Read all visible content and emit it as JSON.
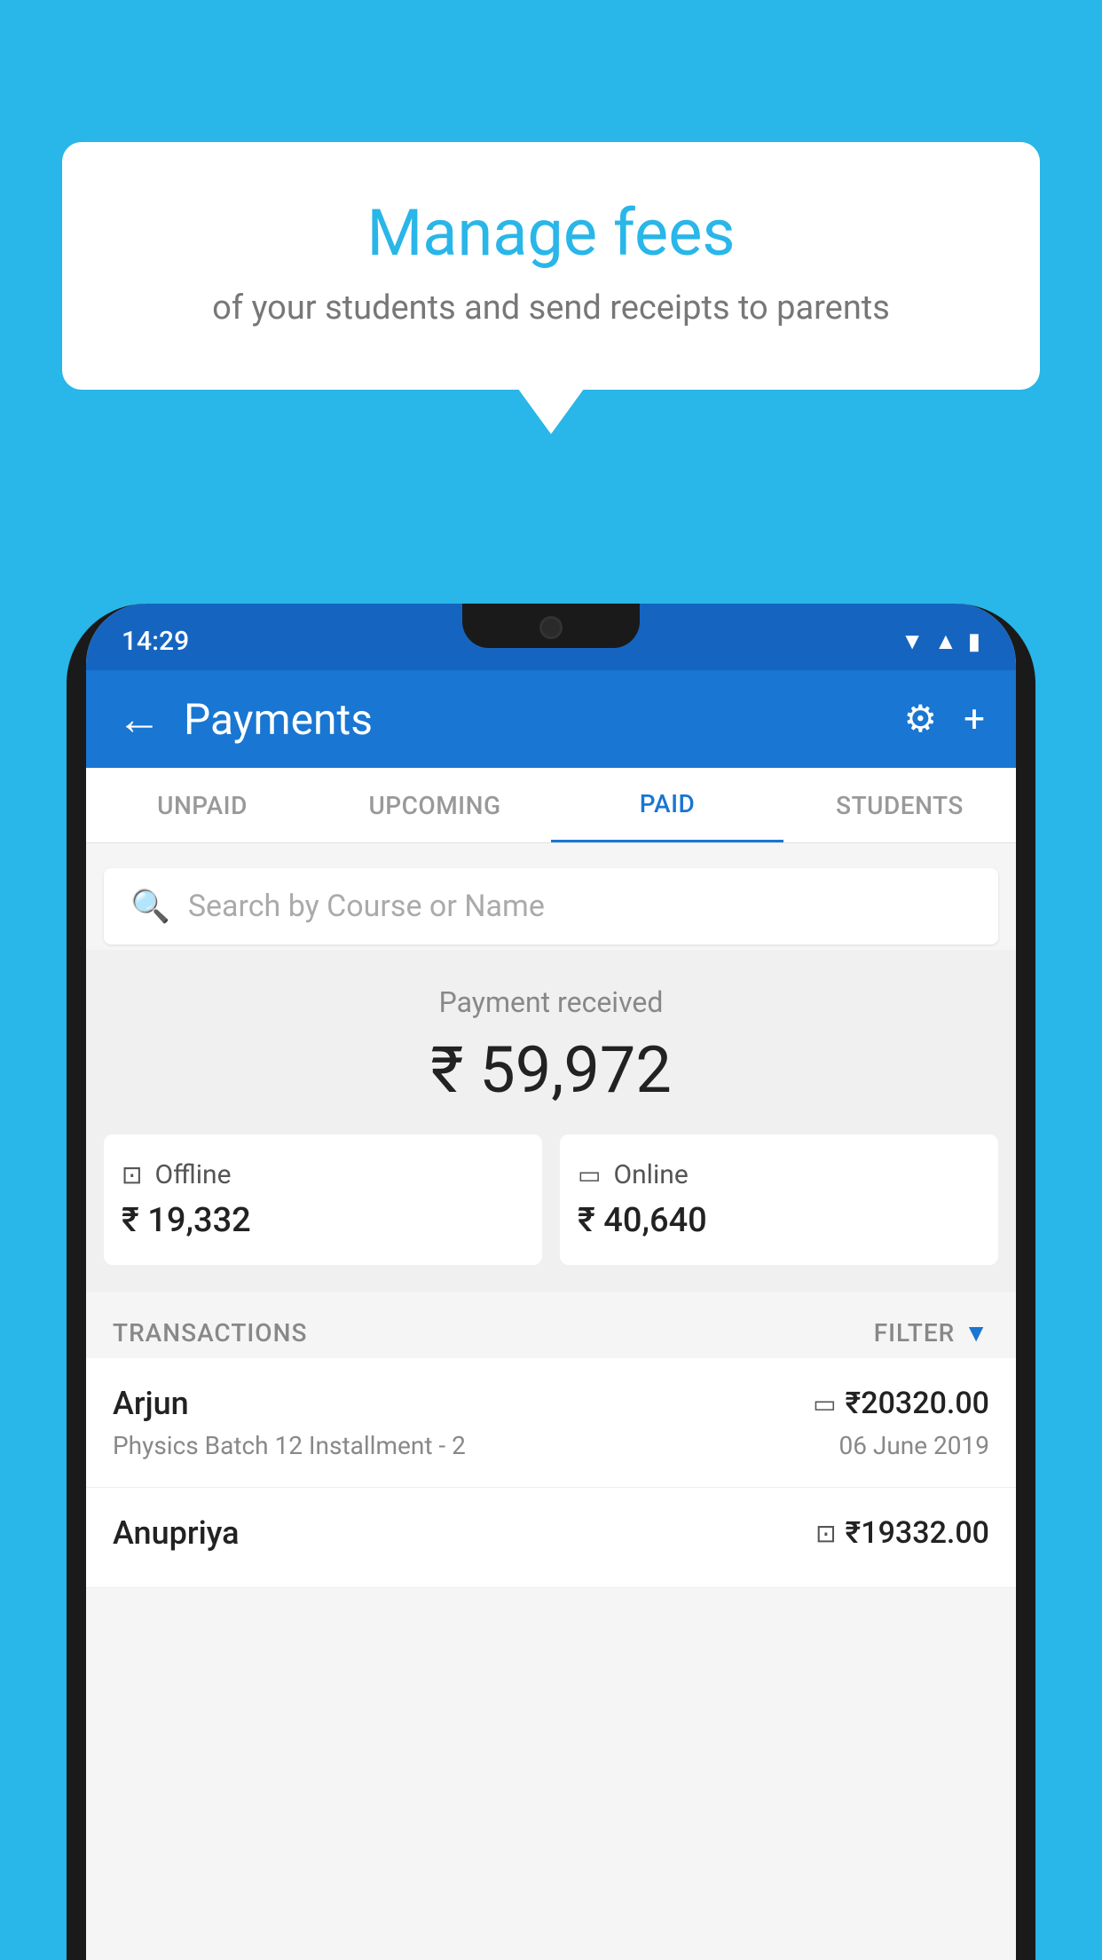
{
  "background_color": "#29B6E8",
  "speech_bubble": {
    "title": "Manage fees",
    "subtitle": "of your students and send receipts to parents"
  },
  "status_bar": {
    "time": "14:29",
    "icons": [
      "wifi",
      "signal",
      "battery"
    ]
  },
  "header": {
    "title": "Payments",
    "back_label": "←",
    "settings_label": "⚙",
    "add_label": "+"
  },
  "tabs": [
    {
      "label": "UNPAID",
      "active": false
    },
    {
      "label": "UPCOMING",
      "active": false
    },
    {
      "label": "PAID",
      "active": true
    },
    {
      "label": "STUDENTS",
      "active": false
    }
  ],
  "search": {
    "placeholder": "Search by Course or Name"
  },
  "payment_summary": {
    "label": "Payment received",
    "amount": "₹ 59,972",
    "offline": {
      "label": "Offline",
      "amount": "₹ 19,332"
    },
    "online": {
      "label": "Online",
      "amount": "₹ 40,640"
    }
  },
  "transactions": {
    "section_label": "TRANSACTIONS",
    "filter_label": "FILTER",
    "items": [
      {
        "name": "Arjun",
        "course": "Physics Batch 12 Installment - 2",
        "amount": "₹20320.00",
        "date": "06 June 2019",
        "payment_type": "online"
      },
      {
        "name": "Anupriya",
        "course": "",
        "amount": "₹19332.00",
        "date": "",
        "payment_type": "offline"
      }
    ]
  }
}
